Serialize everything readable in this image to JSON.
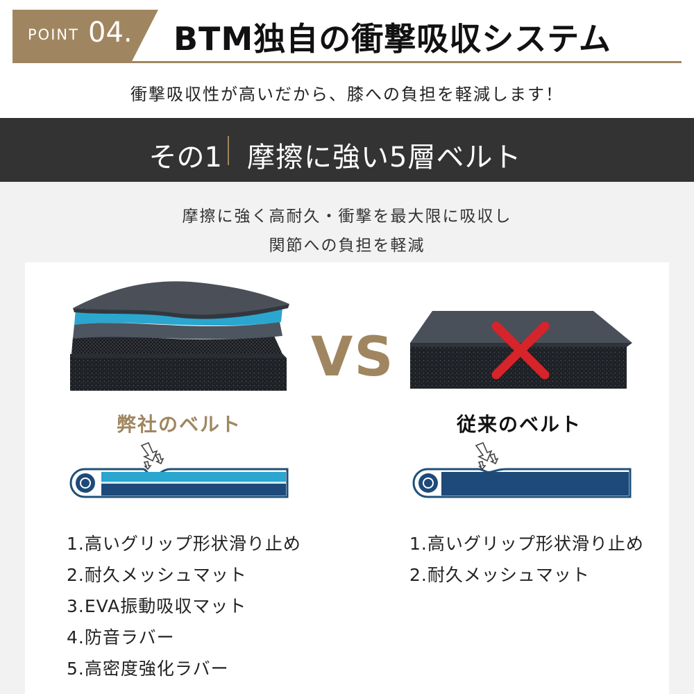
{
  "header": {
    "point_label": "POINT",
    "point_number": "04.",
    "title": "BTM独自の衝撃吸収システム",
    "accent_color": "#a08660"
  },
  "sub_headline": "衝撃吸収性が高いだから、膝への負担を軽減します！",
  "band": {
    "left_label": "その1",
    "right_label": "摩擦に強い5層ベルト"
  },
  "description": {
    "line1": "摩擦に強く高耐久・衝撃を最大限に吸収し",
    "line2": "関節への負担を軽減"
  },
  "vs_label": "VS",
  "our_belt": {
    "title": "弊社のベルト",
    "layers": [
      "1.高いグリップ形状滑り止め",
      "2.耐久メッシュマット",
      "3.EVA振動吸収マット",
      "4.防音ラバー",
      "5.高密度強化ラバー"
    ]
  },
  "conventional_belt": {
    "title": "従来のベルト",
    "layers": [
      "1.高いグリップ形状滑り止め",
      "2.耐久メッシュマット"
    ]
  },
  "icons": {
    "cross": "cross-mark-icon",
    "impact": "impact-arrows-icon",
    "roller": "roller-icon"
  }
}
